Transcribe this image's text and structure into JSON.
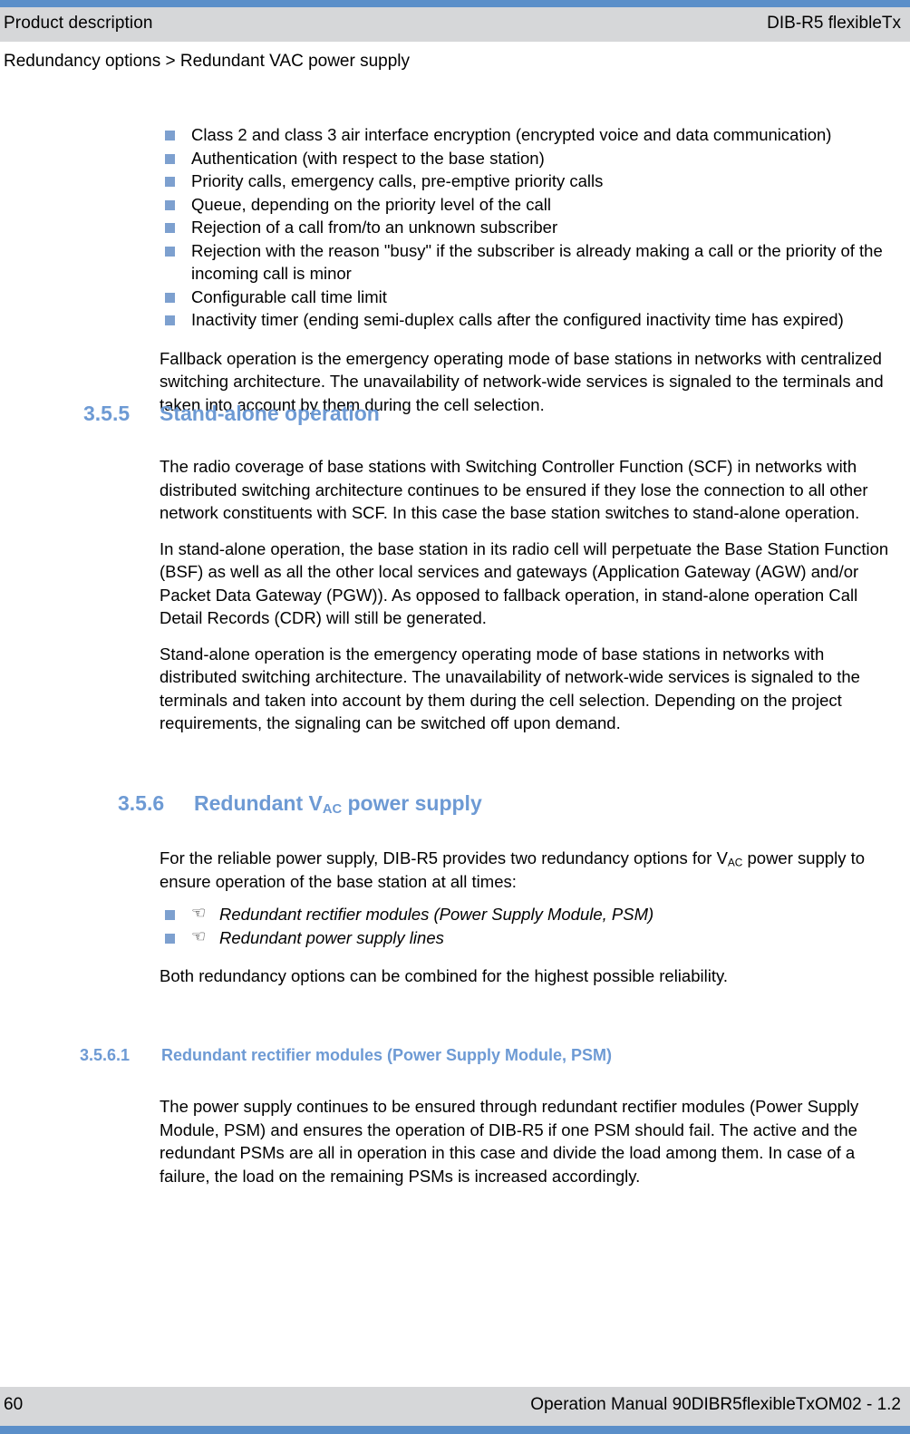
{
  "header": {
    "left_title": "Product description",
    "right_title": "DIB-R5 flexibleTx",
    "breadcrumb": "Redundancy options > Redundant VAC power supply"
  },
  "colors": {
    "accent_rule": "#5b8fc9",
    "band_background": "#d6d7d9",
    "heading_blue": "#6d9ad4",
    "bullet_square": "#7da0cf"
  },
  "feature_list": {
    "items": [
      "Class 2 and class 3 air interface encryption (encrypted voice and data communication)",
      "Authentication (with respect to the base station)",
      "Priority calls, emergency calls, pre-emptive priority calls",
      "Queue, depending on the priority level of the call",
      "Rejection of a call from/to an unknown subscriber",
      "Rejection with the reason \"busy\" if the subscriber is already making a call or the priority of the incoming call is minor",
      "Configurable call time limit",
      "Inactivity timer (ending semi-duplex calls after the configured inactivity time has expired)"
    ]
  },
  "fallback_paragraph": "Fallback operation is the emergency operating mode of base stations in networks with centralized switching architecture. The unavailability of network-wide services is signaled to the terminals and taken into account by them during the cell selection.",
  "section_355": {
    "number": "3.5.5",
    "title": "Stand-alone operation",
    "paragraphs": [
      "The radio coverage of base stations with Switching Controller Function (SCF) in networks with distributed switching architecture continues to be ensured if they lose the connection to all other network constituents with SCF. In this case the base station switches to stand-alone operation.",
      "In stand-alone operation, the base station in its radio cell will perpetuate the Base Station Function (BSF) as well as all the other local services and gateways (Application Gateway (AGW) and/or Packet Data Gateway (PGW)). As opposed to fallback operation, in stand-alone operation Call Detail Records (CDR) will still be generated.",
      "Stand-alone operation is the emergency operating mode of base stations in networks with distributed switching architecture. The unavailability of network-wide services is signaled to the terminals and taken into account by them during the cell selection. Depending on the project requirements, the signaling can be switched off upon demand."
    ]
  },
  "section_356": {
    "number": "3.5.6",
    "title_prefix": "Redundant V",
    "title_subscript": "AC",
    "title_suffix": " power supply",
    "intro_prefix": "For the reliable power supply, DIB-R5 provides two redundancy options for V",
    "intro_subscript": "AC",
    "intro_suffix": " power supply to ensure operation of the base station at all times:",
    "options": [
      "Redundant rectifier modules (Power Supply Module, PSM)",
      "Redundant power supply lines"
    ],
    "pointer_glyph": "☞",
    "closing_paragraph": "Both redundancy options can be combined for the highest possible reliability."
  },
  "section_3561": {
    "number": "3.5.6.1",
    "title": "Redundant rectifier modules (Power Supply Module, PSM)",
    "paragraph": "The power supply continues to be ensured through redundant rectifier modules (Power Supply Module, PSM) and ensures the operation of DIB-R5 if one PSM should fail. The active and the redundant PSMs are all in operation in this case and divide the load among them. In case of a failure, the load on the remaining PSMs is increased accordingly."
  },
  "footer": {
    "page_number": "60",
    "manual_reference": "Operation Manual 90DIBR5flexibleTxOM02 - 1.2"
  }
}
